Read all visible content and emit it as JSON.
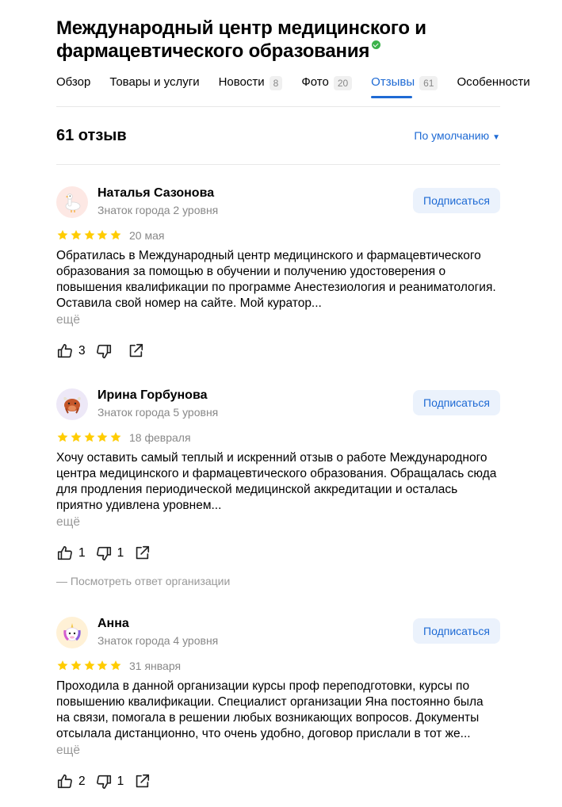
{
  "org": {
    "title": "Международный центр медицинского и фармацевтического образования"
  },
  "tabs": [
    {
      "label": "Обзор",
      "count": ""
    },
    {
      "label": "Товары и услуги",
      "count": ""
    },
    {
      "label": "Новости",
      "count": "8"
    },
    {
      "label": "Фото",
      "count": "20"
    },
    {
      "label": "Отзывы",
      "count": "61"
    },
    {
      "label": "Особенности",
      "count": ""
    }
  ],
  "active_tab": "Отзывы",
  "reviews_header": {
    "count_label": "61 отзыв",
    "sort_label": "По умолчанию"
  },
  "colors": {
    "accent": "#1e6ad4",
    "star": "#fc0",
    "verified": "#3bb24a"
  },
  "reviews": [
    {
      "author": "Наталья Сазонова",
      "level": "Знаток города 2 уровня",
      "avatar_icon": "goose-icon",
      "rating": 5,
      "date": "20 мая",
      "text": "Обратилась в Международный центр медицинского и фармацевтического образования за помощью в обучении и получению удостоверения о повышения квалификации по программе Анестезиология и реаниматология. Оставила свой номер на сайте. Мой куратор...",
      "more": "ещё",
      "likes": "3",
      "dislikes": "",
      "subscribe": "Подписаться"
    },
    {
      "author": "Ирина Горбунова",
      "level": "Знаток города 5 уровня",
      "avatar_icon": "yak-icon",
      "rating": 5,
      "date": "18 февраля",
      "text": "Хочу оставить самый теплый и искренний отзыв о работе Международного центра медицинского и фармацевтического образования. Обращалась сюда для продления периодической медицинской аккредитации и осталась приятно удивлена уровнем...",
      "more": "ещё",
      "likes": "1",
      "dislikes": "1",
      "subscribe": "Подписаться",
      "reply_link": "— Посмотреть ответ организации"
    },
    {
      "author": "Анна",
      "level": "Знаток города 4 уровня",
      "avatar_icon": "unicorn-icon",
      "rating": 5,
      "date": "31 января",
      "text": "Проходила в данной организации курсы проф переподготовки, курсы по повышению квалификации. Специалист организации Яна постоянно была на связи, помогала в решении любых возникающих вопросов. Документы отсылала дистанционно, что очень удобно, договор прислали в тот же...",
      "more": "ещё",
      "likes": "2",
      "dislikes": "1",
      "subscribe": "Подписаться"
    }
  ]
}
